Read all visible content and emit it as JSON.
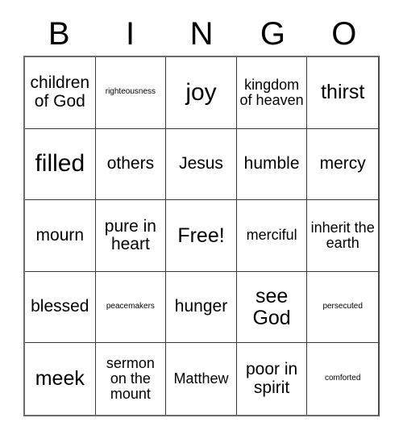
{
  "card": {
    "title": "BINGO",
    "header_letters": [
      "B",
      "I",
      "N",
      "G",
      "O"
    ],
    "free_space_label": "Free!",
    "rows": [
      [
        {
          "text": "children of God",
          "size": "md"
        },
        {
          "text": "righteousness",
          "size": "xs"
        },
        {
          "text": "joy",
          "size": "xl"
        },
        {
          "text": "kingdom of heaven",
          "size": "sm"
        },
        {
          "text": "thirst",
          "size": "lg"
        }
      ],
      [
        {
          "text": "filled",
          "size": "xl"
        },
        {
          "text": "others",
          "size": "md"
        },
        {
          "text": "Jesus",
          "size": "md"
        },
        {
          "text": "humble",
          "size": "md"
        },
        {
          "text": "mercy",
          "size": "md"
        }
      ],
      [
        {
          "text": "mourn",
          "size": "md"
        },
        {
          "text": "pure in heart",
          "size": "md"
        },
        {
          "text": "Free!",
          "size": "lg"
        },
        {
          "text": "merciful",
          "size": "sm"
        },
        {
          "text": "inherit the earth",
          "size": "sm"
        }
      ],
      [
        {
          "text": "blessed",
          "size": "md"
        },
        {
          "text": "peacemakers",
          "size": "xs"
        },
        {
          "text": "hunger",
          "size": "md"
        },
        {
          "text": "see God",
          "size": "lg"
        },
        {
          "text": "persecuted",
          "size": "xs"
        }
      ],
      [
        {
          "text": "meek",
          "size": "lg"
        },
        {
          "text": "sermon on the mount",
          "size": "sm"
        },
        {
          "text": "Matthew",
          "size": "sm"
        },
        {
          "text": "poor in spirit",
          "size": "md"
        },
        {
          "text": "comforted",
          "size": "xs"
        }
      ]
    ]
  },
  "colors": {
    "background": "#ffffff",
    "text": "#000000",
    "grid_line": "#3a3a3a",
    "outer_border": "#6b6b6b"
  }
}
